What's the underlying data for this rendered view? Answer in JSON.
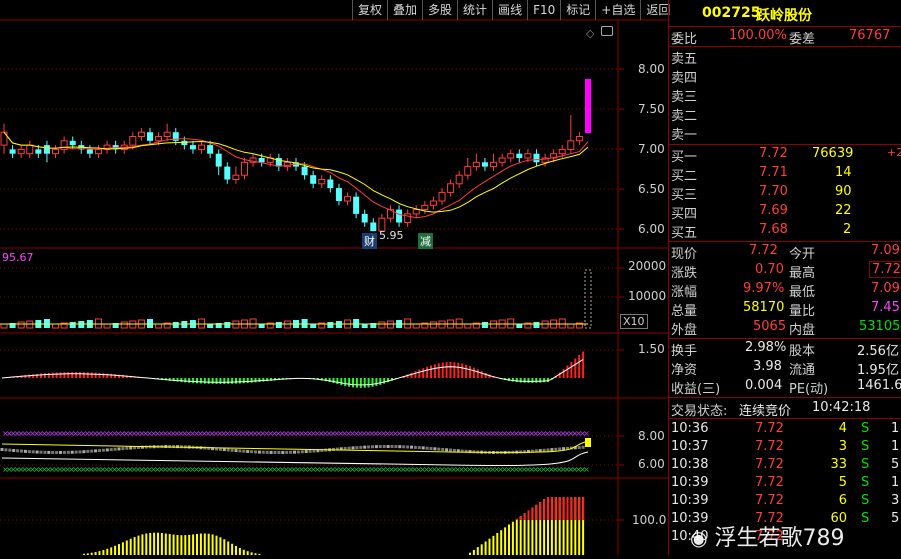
{
  "toolbar": [
    "复权",
    "叠加",
    "多股",
    "统计",
    "画线",
    "F10",
    "标记",
    "+自选",
    "返回"
  ],
  "stock": {
    "code": "002725",
    "name": "跃岭股份"
  },
  "weibi": {
    "label": "委比",
    "value": "100.00%",
    "diff_label": "委差",
    "diff_value": "76767"
  },
  "sell": [
    {
      "label": "卖五"
    },
    {
      "label": "卖四"
    },
    {
      "label": "卖三"
    },
    {
      "label": "卖二"
    },
    {
      "label": "卖一"
    }
  ],
  "buy": [
    {
      "label": "买一",
      "price": "7.72",
      "vol": "76639",
      "chg": "+2"
    },
    {
      "label": "买二",
      "price": "7.71",
      "vol": "14",
      "chg": ""
    },
    {
      "label": "买三",
      "price": "7.70",
      "vol": "90",
      "chg": ""
    },
    {
      "label": "买四",
      "price": "7.69",
      "vol": "22",
      "chg": ""
    },
    {
      "label": "买五",
      "price": "7.68",
      "vol": "2",
      "chg": ""
    }
  ],
  "quote": [
    {
      "l1": "现价",
      "v1": "7.72",
      "l2": "今开",
      "v2": "7.09"
    },
    {
      "l1": "涨跌",
      "v1": "0.70",
      "l2": "最高",
      "v2": "7.72"
    },
    {
      "l1": "涨幅",
      "v1": "9.97%",
      "l2": "最低",
      "v2": "7.09"
    },
    {
      "l1": "总量",
      "v1": "58170",
      "l2": "量比",
      "v2": "7.45"
    },
    {
      "l1": "外盘",
      "v1": "5065",
      "l2": "内盘",
      "v2": "53105"
    }
  ],
  "fund": [
    {
      "l1": "换手",
      "v1": "2.98%",
      "l2": "股本",
      "v2": "2.56亿"
    },
    {
      "l1": "净资",
      "v1": "3.98",
      "l2": "流通",
      "v2": "1.95亿"
    },
    {
      "l1": "收益(三)",
      "v1": "0.004",
      "l2": "PE(动)",
      "v2": "1461.6"
    }
  ],
  "trade_status": {
    "label": "交易状态:",
    "value": "连续竞价",
    "time": "10:42:18"
  },
  "ticks": [
    {
      "time": "10:36",
      "price": "7.72",
      "vol": "4",
      "side": "S",
      "n": "1"
    },
    {
      "time": "10:37",
      "price": "7.72",
      "vol": "3",
      "side": "S",
      "n": "1"
    },
    {
      "time": "10:38",
      "price": "7.72",
      "vol": "33",
      "side": "S",
      "n": "5"
    },
    {
      "time": "10:39",
      "price": "7.72",
      "vol": "5",
      "side": "S",
      "n": "1"
    },
    {
      "time": "10:39",
      "price": "7.72",
      "vol": "6",
      "side": "S",
      "n": "3"
    },
    {
      "time": "10:39",
      "price": "7.72",
      "vol": "60",
      "side": "S",
      "n": "5"
    },
    {
      "time": "10:40",
      "price": "7.72",
      "vol": "",
      "side": "",
      "n": ""
    }
  ],
  "axes": {
    "price_ticks": [
      "8.00",
      "7.50",
      "7.00",
      "6.50",
      "6.00"
    ],
    "vol_ticks": [
      "20000",
      "10000"
    ],
    "vol_unit": "X10",
    "vol_label": "95.67",
    "macd_tick": "1.50",
    "kdj_ticks": [
      "8.00",
      "6.00"
    ],
    "last_tick": "100.0"
  },
  "annotations": {
    "low_price": "5.95",
    "cai": "财",
    "jian": "减"
  },
  "watermark": "浮生若歌789",
  "chart_data": {
    "type": "candlestick",
    "ylim": [
      5.8,
      8.3
    ],
    "candles": [
      [
        6.95,
        7.1,
        6.85,
        7.2
      ],
      [
        6.9,
        6.85,
        6.8,
        6.95
      ],
      [
        6.85,
        6.9,
        6.8,
        6.95
      ],
      [
        6.85,
        6.95,
        6.8,
        7.0
      ],
      [
        6.9,
        6.85,
        6.8,
        6.95
      ],
      [
        6.95,
        6.85,
        6.75,
        7.0
      ],
      [
        6.85,
        6.9,
        6.8,
        6.95
      ],
      [
        6.9,
        7.0,
        6.85,
        7.05
      ],
      [
        7.0,
        6.95,
        6.9,
        7.05
      ],
      [
        6.95,
        6.9,
        6.85,
        7.0
      ],
      [
        6.9,
        6.85,
        6.8,
        6.95
      ],
      [
        6.85,
        6.9,
        6.8,
        6.95
      ],
      [
        6.9,
        6.95,
        6.85,
        7.0
      ],
      [
        6.95,
        6.9,
        6.85,
        7.0
      ],
      [
        6.9,
        6.95,
        6.85,
        7.0
      ],
      [
        6.95,
        7.05,
        6.9,
        7.1
      ],
      [
        7.05,
        7.1,
        7.0,
        7.15
      ],
      [
        7.1,
        7.0,
        6.95,
        7.15
      ],
      [
        7.0,
        7.05,
        6.95,
        7.1
      ],
      [
        7.05,
        7.1,
        7.0,
        7.2
      ],
      [
        7.1,
        7.0,
        6.95,
        7.15
      ],
      [
        7.0,
        6.95,
        6.9,
        7.05
      ],
      [
        6.95,
        6.9,
        6.85,
        7.0
      ],
      [
        6.9,
        6.95,
        6.85,
        7.0
      ],
      [
        6.95,
        6.85,
        6.8,
        7.0
      ],
      [
        6.85,
        6.7,
        6.6,
        6.9
      ],
      [
        6.7,
        6.55,
        6.5,
        6.75
      ],
      [
        6.55,
        6.6,
        6.5,
        6.7
      ],
      [
        6.6,
        6.75,
        6.55,
        6.8
      ],
      [
        6.75,
        6.8,
        6.7,
        6.85
      ],
      [
        6.8,
        6.75,
        6.7,
        6.85
      ],
      [
        6.75,
        6.8,
        6.7,
        6.85
      ],
      [
        6.8,
        6.7,
        6.65,
        6.85
      ],
      [
        6.7,
        6.75,
        6.65,
        6.8
      ],
      [
        6.75,
        6.7,
        6.65,
        6.8
      ],
      [
        6.7,
        6.6,
        6.55,
        6.75
      ],
      [
        6.6,
        6.5,
        6.45,
        6.65
      ],
      [
        6.5,
        6.55,
        6.45,
        6.6
      ],
      [
        6.55,
        6.45,
        6.4,
        6.6
      ],
      [
        6.45,
        6.3,
        6.25,
        6.5
      ],
      [
        6.3,
        6.35,
        6.25,
        6.4
      ],
      [
        6.35,
        6.15,
        6.1,
        6.4
      ],
      [
        6.15,
        6.05,
        6.0,
        6.2
      ],
      [
        6.05,
        5.95,
        5.95,
        6.1
      ],
      [
        5.95,
        6.1,
        5.95,
        6.15
      ],
      [
        6.1,
        6.2,
        6.05,
        6.25
      ],
      [
        6.2,
        6.05,
        6.0,
        6.25
      ],
      [
        6.05,
        6.15,
        6.0,
        6.2
      ],
      [
        6.15,
        6.2,
        6.1,
        6.25
      ],
      [
        6.2,
        6.25,
        6.15,
        6.3
      ],
      [
        6.25,
        6.3,
        6.2,
        6.35
      ],
      [
        6.3,
        6.4,
        6.25,
        6.45
      ],
      [
        6.4,
        6.5,
        6.35,
        6.55
      ],
      [
        6.5,
        6.6,
        6.45,
        6.65
      ],
      [
        6.6,
        6.7,
        6.55,
        6.8
      ],
      [
        6.7,
        6.75,
        6.65,
        6.85
      ],
      [
        6.75,
        6.7,
        6.65,
        6.8
      ],
      [
        6.7,
        6.75,
        6.65,
        6.85
      ],
      [
        6.75,
        6.8,
        6.7,
        6.85
      ],
      [
        6.8,
        6.85,
        6.75,
        6.9
      ],
      [
        6.85,
        6.8,
        6.75,
        6.9
      ],
      [
        6.8,
        6.85,
        6.75,
        6.9
      ],
      [
        6.85,
        6.75,
        6.7,
        6.9
      ],
      [
        6.75,
        6.8,
        6.7,
        6.85
      ],
      [
        6.8,
        6.85,
        6.75,
        6.9
      ],
      [
        6.85,
        6.9,
        6.8,
        6.95
      ],
      [
        6.9,
        7.0,
        6.85,
        7.3
      ],
      [
        7.0,
        7.05,
        6.95,
        7.1
      ],
      [
        7.09,
        7.72,
        7.09,
        7.72
      ]
    ]
  }
}
